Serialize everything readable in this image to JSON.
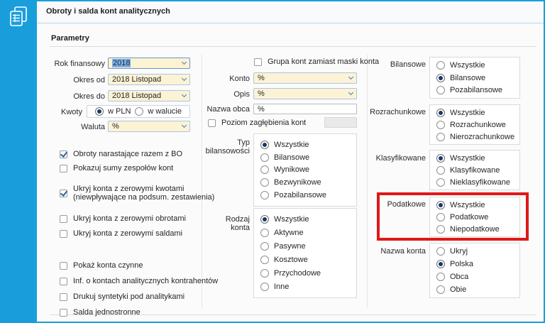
{
  "window": {
    "title": "Obroty i salda kont analitycznych",
    "section_title": "Parametry"
  },
  "colors": {
    "accent_blue": "#1a9edb",
    "combo_fill": "#fcf2d4",
    "radio_dot": "#17386b",
    "highlight_red": "#e01818"
  },
  "left": {
    "rok_finansowy": {
      "label": "Rok finansowy",
      "value": "2018"
    },
    "okres_od": {
      "label": "Okres od",
      "value": "2018 Listopad"
    },
    "okres_do": {
      "label": "Okres do",
      "value": "2018 Listopad"
    },
    "kwoty": {
      "label": "Kwoty",
      "options": [
        {
          "label": "w PLN",
          "selected": true
        },
        {
          "label": "w walucie",
          "selected": false
        }
      ]
    },
    "waluta": {
      "label": "Waluta",
      "value": "%"
    },
    "checkboxes": [
      {
        "label": "Obroty narastające razem z BO",
        "checked": true
      },
      {
        "label": "Pokazuj sumy zespołów kont",
        "checked": false
      },
      {
        "label": "Ukryj konta z zerowymi kwotami",
        "label_line2": "(niewpływające na podsum. zestawienia)",
        "checked": true
      },
      {
        "label": "Ukryj konta z zerowymi obrotami",
        "checked": false
      },
      {
        "label": "Ukryj konta z zerowymi saldami",
        "checked": false
      },
      {
        "label": "Pokaż konta czynne",
        "checked": false
      },
      {
        "label": "Inf. o kontach analitycznych kontrahentów",
        "checked": false
      },
      {
        "label": "Drukuj syntetyki pod analitykami",
        "checked": false
      },
      {
        "label": "Salda jednostronne",
        "checked": false
      }
    ]
  },
  "middle": {
    "grupa_kont": {
      "label": "Grupa kont zamiast maski konta",
      "checked": false
    },
    "konto": {
      "label": "Konto",
      "value": "%"
    },
    "opis": {
      "label": "Opis",
      "value": "%"
    },
    "nazwa_obca": {
      "label": "Nazwa obca",
      "value": "%"
    },
    "poziom": {
      "label": "Poziom zagłębienia kont",
      "checked": false,
      "value": ""
    },
    "typ_bilansowosci": {
      "label_line1": "Typ",
      "label_line2": "bilansowości",
      "options": [
        {
          "label": "Wszystkie",
          "selected": true
        },
        {
          "label": "Bilansowe",
          "selected": false
        },
        {
          "label": "Wynikowe",
          "selected": false
        },
        {
          "label": "Bezwynikowe",
          "selected": false
        },
        {
          "label": "Pozabilansowe",
          "selected": false
        }
      ]
    },
    "rodzaj_konta": {
      "label_line1": "Rodzaj",
      "label_line2": "konta",
      "options": [
        {
          "label": "Wszystkie",
          "selected": true
        },
        {
          "label": "Aktywne",
          "selected": false
        },
        {
          "label": "Pasywne",
          "selected": false
        },
        {
          "label": "Kosztowe",
          "selected": false
        },
        {
          "label": "Przychodowe",
          "selected": false
        },
        {
          "label": "Inne",
          "selected": false
        }
      ]
    }
  },
  "right": {
    "bilansowe": {
      "label": "Bilansowe",
      "options": [
        {
          "label": "Wszystkie",
          "selected": false
        },
        {
          "label": "Bilansowe",
          "selected": true
        },
        {
          "label": "Pozabilansowe",
          "selected": false
        }
      ]
    },
    "rozrachunkowe": {
      "label": "Rozrachunkowe",
      "options": [
        {
          "label": "Wszystkie",
          "selected": true
        },
        {
          "label": "Rozrachunkowe",
          "selected": false
        },
        {
          "label": "Nierozrachunkowe",
          "selected": false
        }
      ]
    },
    "klasyfikowane": {
      "label": "Klasyfikowane",
      "options": [
        {
          "label": "Wszystkie",
          "selected": true
        },
        {
          "label": "Klasyfikowane",
          "selected": false
        },
        {
          "label": "Nieklasyfikowane",
          "selected": false
        }
      ]
    },
    "podatkowe": {
      "label": "Podatkowe",
      "highlighted": true,
      "options": [
        {
          "label": "Wszystkie",
          "selected": true
        },
        {
          "label": "Podatkowe",
          "selected": false
        },
        {
          "label": "Niepodatkowe",
          "selected": false
        }
      ]
    },
    "nazwa_konta": {
      "label": "Nazwa konta",
      "options": [
        {
          "label": "Ukryj",
          "selected": false
        },
        {
          "label": "Polska",
          "selected": true
        },
        {
          "label": "Obca",
          "selected": false
        },
        {
          "label": "Obie",
          "selected": false
        }
      ]
    }
  }
}
